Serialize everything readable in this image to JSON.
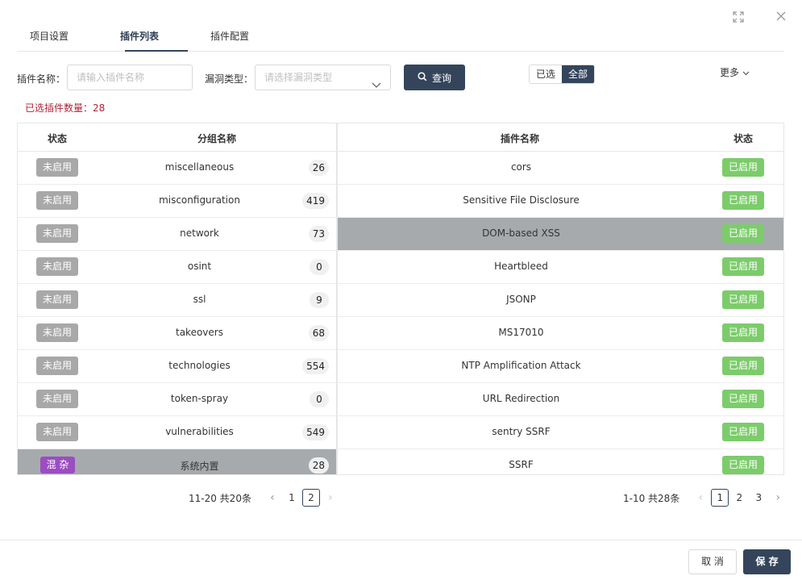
{
  "tabs": [
    {
      "label": "项目设置"
    },
    {
      "label": "插件列表"
    },
    {
      "label": "插件配置"
    }
  ],
  "filter": {
    "name_label": "插件名称：",
    "name_placeholder": "请输入插件名称",
    "type_label": "漏洞类型：",
    "type_placeholder": "请选择漏洞类型",
    "query_label": "查询",
    "seg_selected": "已选",
    "seg_all": "全部",
    "more_label": "更多"
  },
  "selected_count_text": "已选插件数量：28",
  "groups": {
    "headers": {
      "status": "状态",
      "name": "分组名称"
    },
    "rows": [
      {
        "status": "未启用",
        "name": "miscellaneous",
        "count": "26"
      },
      {
        "status": "未启用",
        "name": "misconfiguration",
        "count": "419"
      },
      {
        "status": "未启用",
        "name": "network",
        "count": "73"
      },
      {
        "status": "未启用",
        "name": "osint",
        "count": "0"
      },
      {
        "status": "未启用",
        "name": "ssl",
        "count": "9"
      },
      {
        "status": "未启用",
        "name": "takeovers",
        "count": "68"
      },
      {
        "status": "未启用",
        "name": "technologies",
        "count": "554"
      },
      {
        "status": "未启用",
        "name": "token-spray",
        "count": "0"
      },
      {
        "status": "未启用",
        "name": "vulnerabilities",
        "count": "549"
      },
      {
        "status": "混 杂",
        "name": "系统内置",
        "count": "28"
      }
    ],
    "pager": {
      "total": "11-20 共20条",
      "pages": [
        "1",
        "2"
      ],
      "current": "2"
    }
  },
  "plugins": {
    "headers": {
      "name": "插件名称",
      "status": "状态"
    },
    "rows": [
      {
        "name": "cors",
        "status": "已启用"
      },
      {
        "name": "Sensitive File Disclosure",
        "status": "已启用"
      },
      {
        "name": "DOM-based XSS",
        "status": "已启用"
      },
      {
        "name": "Heartbleed",
        "status": "已启用"
      },
      {
        "name": "JSONP",
        "status": "已启用"
      },
      {
        "name": "MS17010",
        "status": "已启用"
      },
      {
        "name": "NTP Amplification Attack",
        "status": "已启用"
      },
      {
        "name": "URL Redirection",
        "status": "已启用"
      },
      {
        "name": "sentry SSRF",
        "status": "已启用"
      },
      {
        "name": "SSRF",
        "status": "已启用"
      }
    ],
    "pager": {
      "total": "1-10 共28条",
      "pages": [
        "1",
        "2",
        "3"
      ],
      "current": "1"
    }
  },
  "footer": {
    "cancel_label": "取 消",
    "save_label": "保 存"
  },
  "colors": {
    "primary": "#34455b",
    "enabled": "#7ccc6b",
    "disabled": "#a8a8a8",
    "mixed": "#9b4dc2",
    "count_text": "#b3213a"
  }
}
